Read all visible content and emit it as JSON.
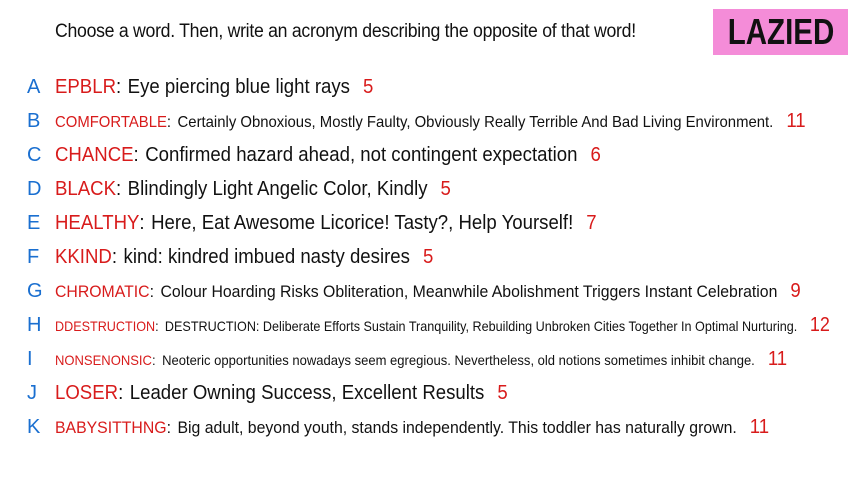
{
  "prompt": "Choose a word. Then, write an acronym describing the opposite of that word!",
  "badge": {
    "label": "LAZIED",
    "color": "#f48cd8"
  },
  "colors": {
    "letter": "#1a6fd0",
    "word": "#d81b1b",
    "count": "#d81b1b"
  },
  "rows": [
    {
      "letter": "A",
      "word": "EPBLR",
      "acronym": "Eye piercing blue light rays",
      "count": "5"
    },
    {
      "letter": "B",
      "word": "COMFORTABLE",
      "acronym": "Certainly Obnoxious, Mostly Faulty, Obviously Really Terrible And Bad Living Environment.",
      "count": "11"
    },
    {
      "letter": "C",
      "word": "CHANCE",
      "acronym": "Confirmed hazard ahead, not contingent expectation",
      "count": "6"
    },
    {
      "letter": "D",
      "word": "BLACK",
      "acronym": "Blindingly Light Angelic Color, Kindly",
      "count": "5"
    },
    {
      "letter": "E",
      "word": "HEALTHY",
      "acronym": "Here, Eat Awesome Licorice! Tasty?, Help Yourself!",
      "count": "7"
    },
    {
      "letter": "F",
      "word": "KKIND",
      "acronym": "kind: kindred imbued nasty desires",
      "count": "5"
    },
    {
      "letter": "G",
      "word": "CHROMATIC",
      "acronym": "Colour Hoarding Risks Obliteration, Meanwhile Abolishment Triggers Instant Celebration",
      "count": "9"
    },
    {
      "letter": "H",
      "word": "DDESTRUCTION",
      "acronym": "DESTRUCTION: Deliberate Efforts Sustain Tranquility, Rebuilding Unbroken Cities Together In Optimal Nurturing.",
      "count": "12"
    },
    {
      "letter": "I",
      "word": "NONSENONSIC",
      "acronym": "Neoteric opportunities nowadays seem egregious. Nevertheless, old notions sometimes inhibit change.",
      "count": "11"
    },
    {
      "letter": "J",
      "word": "LOSER",
      "acronym": "Leader Owning Success, Excellent Results",
      "count": "5"
    },
    {
      "letter": "K",
      "word": "BABYSITTHNG",
      "acronym": "Big adult, beyond youth, stands independently. This toddler has naturally grown.",
      "count": "11"
    }
  ]
}
